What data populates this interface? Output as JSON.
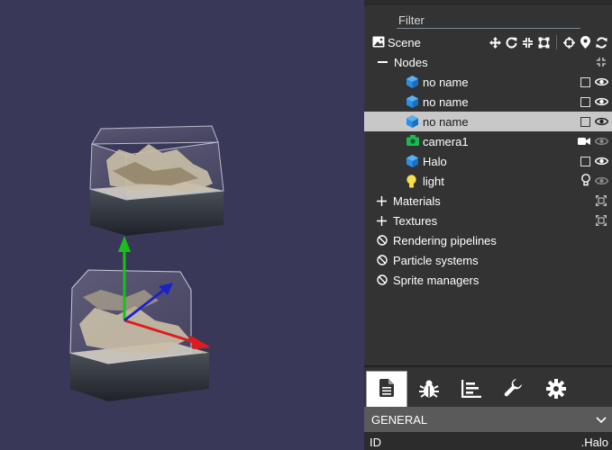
{
  "filter": {
    "placeholder": "Filter"
  },
  "scene": {
    "label": "Scene"
  },
  "nodes": {
    "label": "Nodes",
    "items": [
      {
        "label": "no name",
        "type": "mesh"
      },
      {
        "label": "no name",
        "type": "mesh"
      },
      {
        "label": "no name",
        "type": "mesh",
        "selected": true
      },
      {
        "label": "camera1",
        "type": "camera"
      },
      {
        "label": "Halo",
        "type": "mesh"
      },
      {
        "label": "light",
        "type": "light"
      }
    ]
  },
  "sections": {
    "materials": "Materials",
    "textures": "Textures",
    "rendering_pipelines": "Rendering pipelines",
    "particle_systems": "Particle systems",
    "sprite_managers": "Sprite managers"
  },
  "tabs": [
    "document-icon",
    "bug-icon",
    "chart-icon",
    "wrench-icon",
    "gear-icon"
  ],
  "general": {
    "label": "GENERAL"
  },
  "property": {
    "key": "ID",
    "value": ".Halo"
  },
  "colors": {
    "viewport_bg": "#3a3858",
    "panel_bg": "#333333",
    "selected_row": "#c8c8c8",
    "mesh_icon": "#2a8fe6",
    "camera_icon": "#1db954",
    "light_icon": "#f5e04a",
    "gizmo_x": "#e01b1b",
    "gizmo_y": "#1bbf1b",
    "gizmo_z": "#1b22c8"
  }
}
